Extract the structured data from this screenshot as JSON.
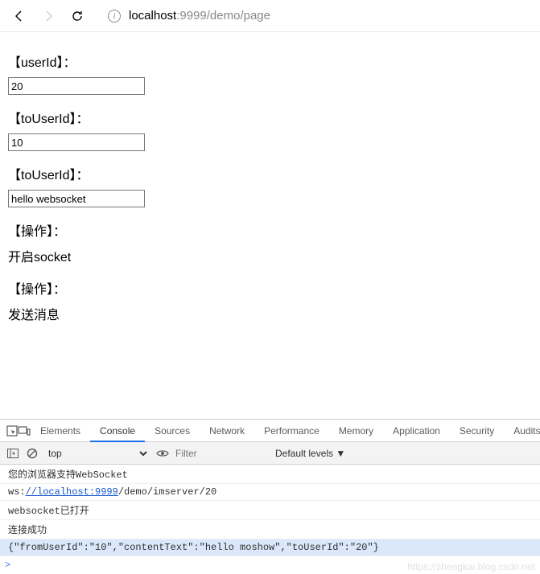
{
  "navbar": {
    "url_host": "localhost",
    "url_port": ":9999",
    "url_path": "/demo/page"
  },
  "page": {
    "labels": {
      "userId": "【userId】：",
      "toUserId": "【toUserId】：",
      "message": "【toUserId】：",
      "op1": "【操作】：",
      "op2": "【操作】："
    },
    "inputs": {
      "userId": "20",
      "toUserId": "10",
      "message": "hello websocket"
    },
    "actions": {
      "open": "开启socket",
      "send": "发送消息"
    }
  },
  "devtools": {
    "tabs": [
      "Elements",
      "Console",
      "Sources",
      "Network",
      "Performance",
      "Memory",
      "Application",
      "Security",
      "Audits"
    ],
    "active_tab": "Console",
    "context": "top",
    "filter_placeholder": "Filter",
    "levels": "Default levels ▼",
    "console": [
      {
        "text": "您的浏览器支持WebSocket"
      },
      {
        "prefix": "ws:",
        "link": "//localhost:9999",
        "suffix": "/demo/imserver/20"
      },
      {
        "text": "websocket已打开"
      },
      {
        "text": "连接成功"
      },
      {
        "text": "{\"fromUserId\":\"10\",\"contentText\":\"hello moshow\",\"toUserId\":\"20\"}",
        "highlighted": true
      }
    ],
    "prompt": ">"
  },
  "watermark": "https://zhengkai.blog.csdn.net"
}
